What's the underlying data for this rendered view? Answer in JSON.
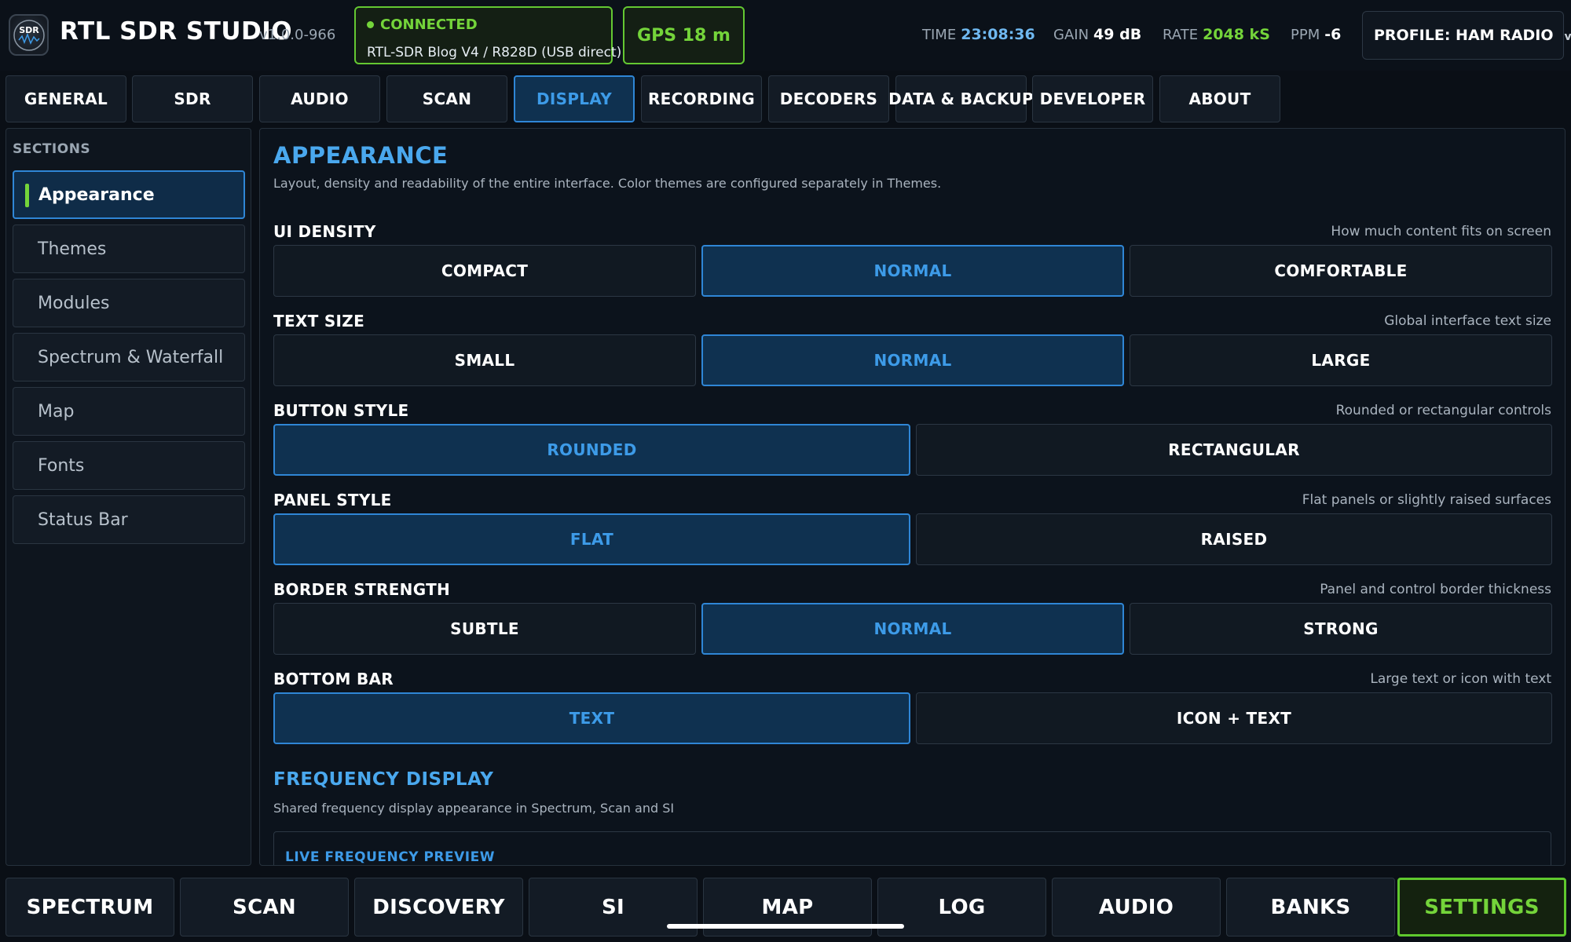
{
  "header": {
    "logo_icon": "sdr-app-logo-icon",
    "title": "RTL SDR STUDIO",
    "version": "v1.0.0-966",
    "connection": {
      "status": "CONNECTED",
      "device": "RTL-SDR Blog V4 / R828D (USB direct)",
      "color": "#74d43a"
    },
    "gps": "GPS 18 m",
    "stats": {
      "time_label": "TIME",
      "time_value": "23:08:36",
      "gain_label": "GAIN",
      "gain_value": "49 dB",
      "rate_label": "RATE",
      "rate_value": "2048 kS",
      "ppm_label": "PPM",
      "ppm_value": "-6"
    },
    "profile_label": "PROFILE: HAM RADIO",
    "profile_chevron": "v"
  },
  "tabs": [
    {
      "label": "GENERAL",
      "active": false
    },
    {
      "label": "SDR",
      "active": false
    },
    {
      "label": "AUDIO",
      "active": false
    },
    {
      "label": "SCAN",
      "active": false
    },
    {
      "label": "DISPLAY",
      "active": true
    },
    {
      "label": "RECORDING",
      "active": false
    },
    {
      "label": "DECODERS",
      "active": false
    },
    {
      "label": "DATA & BACKUP",
      "active": false
    },
    {
      "label": "DEVELOPER",
      "active": false
    },
    {
      "label": "ABOUT",
      "active": false
    }
  ],
  "sidebar": {
    "heading": "SECTIONS",
    "items": [
      {
        "label": "Appearance",
        "active": true
      },
      {
        "label": "Themes",
        "active": false
      },
      {
        "label": "Modules",
        "active": false
      },
      {
        "label": "Spectrum & Waterfall",
        "active": false
      },
      {
        "label": "Map",
        "active": false
      },
      {
        "label": "Fonts",
        "active": false
      },
      {
        "label": "Status Bar",
        "active": false
      }
    ]
  },
  "main": {
    "appearance": {
      "title": "APPEARANCE",
      "description": "Layout, density and readability of the entire interface. Color themes are configured separately in Themes.",
      "settings": [
        {
          "label": "UI DENSITY",
          "hint": "How much content fits on screen",
          "options": [
            "COMPACT",
            "NORMAL",
            "COMFORTABLE"
          ],
          "selected": "NORMAL"
        },
        {
          "label": "TEXT SIZE",
          "hint": "Global interface text size",
          "options": [
            "SMALL",
            "NORMAL",
            "LARGE"
          ],
          "selected": "NORMAL"
        },
        {
          "label": "BUTTON STYLE",
          "hint": "Rounded or rectangular controls",
          "options": [
            "ROUNDED",
            "RECTANGULAR"
          ],
          "selected": "ROUNDED"
        },
        {
          "label": "PANEL STYLE",
          "hint": "Flat panels or slightly raised surfaces",
          "options": [
            "FLAT",
            "RAISED"
          ],
          "selected": "FLAT"
        },
        {
          "label": "BORDER STRENGTH",
          "hint": "Panel and control border thickness",
          "options": [
            "SUBTLE",
            "NORMAL",
            "STRONG"
          ],
          "selected": "NORMAL"
        },
        {
          "label": "BOTTOM BAR",
          "hint": "Large text or icon with text",
          "options": [
            "TEXT",
            "ICON + TEXT"
          ],
          "selected": "TEXT"
        }
      ]
    },
    "frequency_display": {
      "title": "FREQUENCY DISPLAY",
      "description": "Shared frequency display appearance in Spectrum, Scan and SI",
      "preview_label": "LIVE FREQUENCY PREVIEW"
    }
  },
  "bottom_nav": [
    {
      "label": "SPECTRUM",
      "active": false
    },
    {
      "label": "SCAN",
      "active": false
    },
    {
      "label": "DISCOVERY",
      "active": false
    },
    {
      "label": "SI",
      "active": false
    },
    {
      "label": "MAP",
      "active": false
    },
    {
      "label": "LOG",
      "active": false
    },
    {
      "label": "AUDIO",
      "active": false
    },
    {
      "label": "BANKS",
      "active": false
    },
    {
      "label": "SETTINGS",
      "active": true
    }
  ],
  "colors": {
    "accent_blue": "#2f86d6",
    "active_text_blue": "#3d9be8",
    "accent_green": "#74d43a",
    "background": "#0a0f16"
  }
}
